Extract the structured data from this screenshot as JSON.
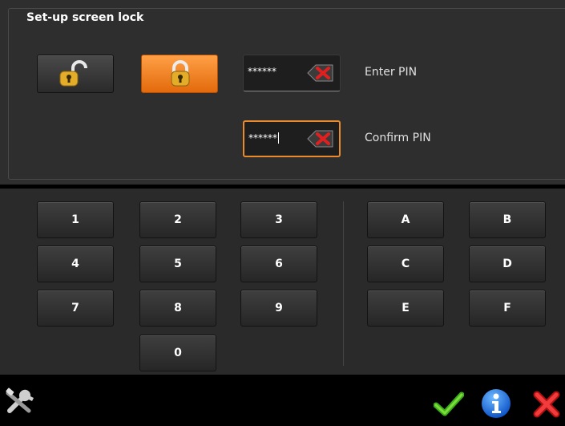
{
  "dialog": {
    "title": "Set-up screen lock"
  },
  "lock_modes": {
    "unlocked_icon": "unlocked-padlock-icon",
    "locked_icon": "locked-padlock-icon",
    "selected": "locked",
    "accent_color": "#f28a2a"
  },
  "pin": {
    "enter_value": "******",
    "enter_label": "Enter PIN",
    "confirm_value": "******",
    "confirm_label": "Confirm PIN",
    "clear_icon": "backspace-clear-icon"
  },
  "keypad": {
    "digits": [
      "1",
      "2",
      "3",
      "4",
      "5",
      "6",
      "7",
      "8",
      "9",
      "0"
    ],
    "letters": [
      "A",
      "B",
      "C",
      "D",
      "E",
      "F"
    ]
  },
  "toolbar": {
    "tools_icon": "tools-icon",
    "confirm_icon": "checkmark-icon",
    "info_icon": "info-icon",
    "cancel_icon": "close-icon"
  }
}
